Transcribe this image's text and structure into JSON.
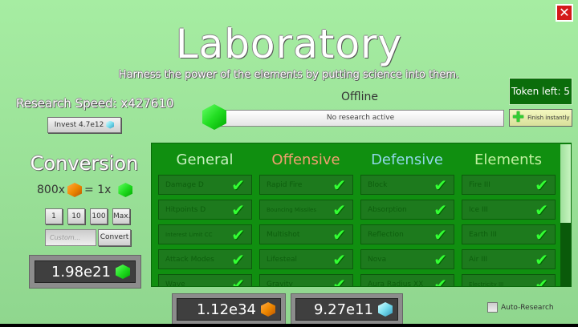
{
  "title": "Laboratory",
  "subtitle": "Harness the power of the elements by putting science into them.",
  "close_label": "✕",
  "research_speed": "Research Speed: x427610",
  "invest_label": "Invest 4.7e12",
  "conversion": {
    "title": "Conversion",
    "from": "800x",
    "eq": "= 1x",
    "amounts": [
      "1",
      "10",
      "100",
      "Max."
    ],
    "custom_placeholder": "Custom...",
    "convert_label": "Convert",
    "green_balance": "1.98e21"
  },
  "status": "Offline",
  "progress": {
    "text": "No research active",
    "fraction": 0
  },
  "token_label": "Token left: 5",
  "finish_label": "Finish instantly",
  "columns": [
    {
      "title": "General",
      "color": "#c8f0c0",
      "items": [
        "Damage D",
        "Hitpoints D",
        "Interest Limit CC",
        "Attack Modes",
        "Wave"
      ]
    },
    {
      "title": "Offensive",
      "color": "#f0a070",
      "items": [
        "Rapid Fire",
        "Bouncing Missiles",
        "Multishot",
        "Lifesteal",
        "Gravity"
      ]
    },
    {
      "title": "Defensive",
      "color": "#90d8e8",
      "items": [
        "Block",
        "Absorption",
        "Reflection",
        "Nova",
        "Aura Radius XX"
      ]
    },
    {
      "title": "Elements",
      "color": "#c0f0a0",
      "items": [
        "Fire III",
        "Ice III",
        "Earth III",
        "Air III",
        "Electricity III"
      ]
    }
  ],
  "orange_balance": "1.12e34",
  "cyan_balance": "9.27e11",
  "auto_research_label": "Auto-Research",
  "auto_research_checked": false
}
